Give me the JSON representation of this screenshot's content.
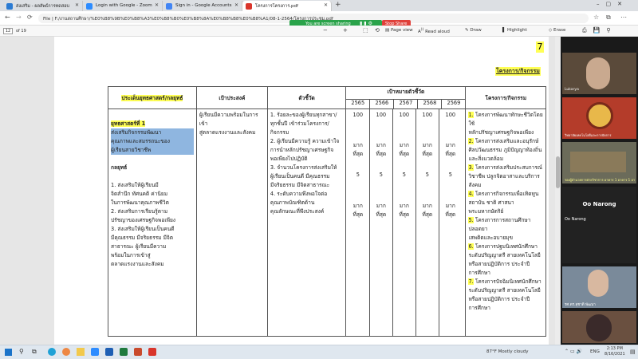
{
  "browser": {
    "tabs": [
      {
        "title": "ส่งเสริม - ผลลัพธ์การทดสอบ"
      },
      {
        "title": "Login with Google - Zoom"
      },
      {
        "title": "Sign in - Google Accounts"
      },
      {
        "title": "โครงการโครงการ.pdf"
      }
    ],
    "address": "File  |  F:/งานสถานศึกษา/%E0%B8%9B%E0%B8%A3%E0%B8%B0%E0%B8%8A%E0%B8%B8%E0%B8%A1/08-1-2564/โครงการประชุม.pdf",
    "sharing_text": "You are screen sharing",
    "stop_share": "Stop Share"
  },
  "pdf_toolbar": {
    "page_current": "12",
    "page_total": "of 19",
    "page_view": "Page view",
    "read_aloud": "Read aloud",
    "draw": "Draw",
    "highlight": "Highlight",
    "erase": "Erase"
  },
  "document": {
    "page_number": "7",
    "section_label": "โครงการ/กิจกรรม",
    "headers": {
      "strategy": "ประเด็นยุทธศาสตร์/กลยุทธ์",
      "goal": "เป้าประสงค์",
      "indicator": "ตัวชี้วัด",
      "target": "เป้าหมายตัวชี้วัด",
      "years": [
        "2565",
        "2566",
        "2567",
        "2568",
        "2569"
      ],
      "project": "โครงการ/กิจกรรม"
    },
    "strategy_title": "ยุทธศาสตร์ที่ 1",
    "strategy_selected": "ส่งเสริมกิจกรรมพัฒนา\nคุณภาพและสมรรถนะของ\nผู้เรียนสายวิชาชีพ",
    "strategy_sub": "กลยุทธ์",
    "strategy_items": "1. ส่งเสริมให้ผู้เรียนมี\nจิตสำนึก ทัศนคติ ค่านิยม\nในการพัฒนาคุณภาพชีวิต\n2. ส่งเสริมการเรียนรู้ตาม\nปรัชญาของเศรษฐกิจพอเพียง\n3. ส่งเสริมให้ผู้เรียนเป็นคนดี\nมีคุณธรรม มีจริยธรรม มีจิต\nสาธารณะ ผู้เรียนมีความ\nพร้อมในการเข้าสู่\nตลาดแรงงานและสังคม",
    "goal_text": "ผู้เรียนมีความพร้อมในการเข้า\nสู่ตลาดแรงงานและสังคม",
    "indicators": "1. ร้อยละของผู้เรียนทุกสาขา/\nทุกชั้นปี เข้าร่วมโครงการ/\nกิจกรรม\n2. ผู้เรียนมีความรู้ ความเข้าใจ\nการนำหลักปรัชญาเศรษฐกิจ\nพอเพียงไปปฏิบัติ\n3. จำนวนโครงการส่งเสริมให้\nผู้เรียนเป็นคนดี มีคุณธรรม\nมีจริยธรรม มีจิตสาธารณะ\n4. ระดับความพึงพอใจต่อ\nคุณภาพบัณฑิตด้าน\nคุณลักษณะที่พึงประสงค์",
    "target_rows": [
      [
        "100",
        "100",
        "100",
        "100",
        "100"
      ],
      [
        "มาก\nที่สุด",
        "มาก\nที่สุด",
        "มาก\nที่สุด",
        "มาก\nที่สุด",
        "มาก\nที่สุด"
      ],
      [
        "5",
        "5",
        "5",
        "5",
        "5"
      ],
      [
        "มาก\nที่สุด",
        "มาก\nที่สุด",
        "มาก\nที่สุด",
        "มาก\nที่สุด",
        "มาก\nที่สุด"
      ]
    ],
    "projects": [
      {
        "num": "1.",
        "text": " โครงการพัฒนาทักษะชีวิตโดยใช้\nหลักปรัชญาเศรษฐกิจพอเพียง"
      },
      {
        "num": "2.",
        "text": " โครงการส่งเสริมและอนุรักษ์\nศิลปวัฒนธรรม ภูมิปัญญาท้องถิ่น\nและสิ่งแวดล้อม"
      },
      {
        "num": "3.",
        "text": " โครงการส่งเสริมประสบการณ์\nวิชาชีพ ปลูกจิตอาสาและบริการ\nสังคม"
      },
      {
        "num": "4.",
        "text": " โครงการกิจกรรมเพื่อเทิดทูน\nสถาบัน ชาติ ศาสนา\nพระมหากษัตริย์"
      },
      {
        "num": "5.",
        "text": " โครงการการสถานศึกษาปลอดยา\nเสพติดและอบายมุข"
      },
      {
        "num": "6.",
        "text": " โครงการปฐมนิเทศนักศึกษา\nระดับปริญญาตรี สายเทคโนโลยี\nหรือสายปฏิบัติการ ประจำปี\nการศึกษา"
      },
      {
        "num": "7.",
        "text": " โครงการปัจฉิมนิเทศนักศึกษา\nระดับปริญญาตรี สายเทคโนโลยี\nหรือสายปฏิบัติการ ประจำปี\nการศึกษา"
      }
    ]
  },
  "zoom": {
    "participants": [
      {
        "name": "Lukarya",
        "color": "#5a4a3a"
      },
      {
        "name": "วิทยาลัยเทคโนโลยีและการจัดการ",
        "color": "#b43c2a"
      },
      {
        "name": "รองผู้อำนวยการฝ่ายวิชาการ อาคาร 1 อาคาร 1 อาคาร 1",
        "color": "#6b6b5a"
      },
      {
        "name": "Oo Narong",
        "color": "#222222"
      },
      {
        "name": "รศ.ดร.สุชาติ พัฒนา",
        "color": "#7a8a9a"
      },
      {
        "name": "",
        "color": "#6a5040"
      }
    ],
    "big_name": "Oo Narong"
  },
  "taskbar": {
    "weather": "87°F  Mostly cloudy",
    "lang": "ENG",
    "time": "2:13 PM",
    "date": "8/16/2021"
  }
}
